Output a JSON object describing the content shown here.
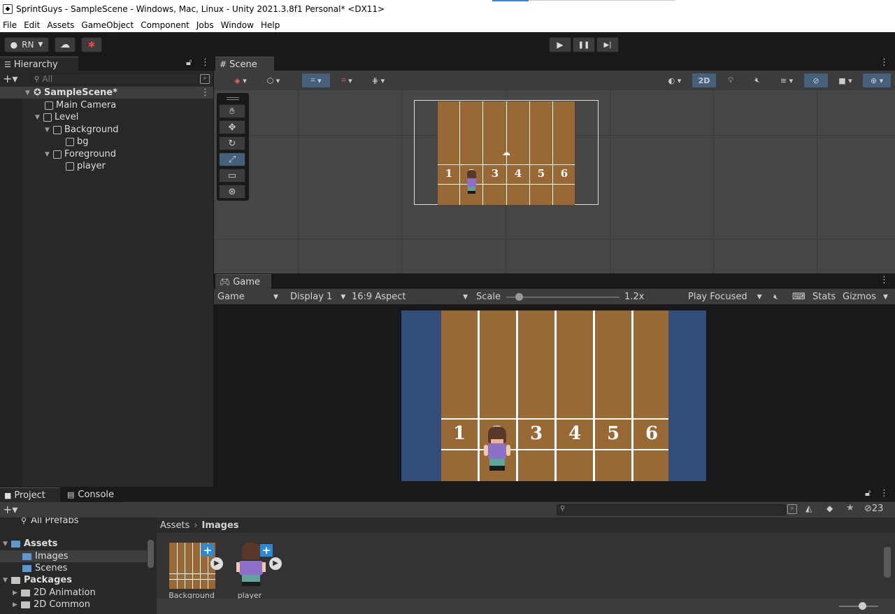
{
  "window": {
    "title": "SprintGuys - SampleScene - Windows, Mac, Linux - Unity 2021.3.8f1 Personal* <DX11>"
  },
  "menu": [
    "File",
    "Edit",
    "Assets",
    "GameObject",
    "Component",
    "Jobs",
    "Window",
    "Help"
  ],
  "toolbar": {
    "account": "RN",
    "play_icon": "▶",
    "pause_icon": "❚❚",
    "step_icon": "▶|"
  },
  "hierarchy": {
    "tab": "Hierarchy",
    "search_placeholder": "All",
    "items": [
      {
        "label": "SampleScene*",
        "depth": 0
      },
      {
        "label": "Main Camera",
        "depth": 1
      },
      {
        "label": "Level",
        "depth": 1
      },
      {
        "label": "Background",
        "depth": 2
      },
      {
        "label": "bg",
        "depth": 3
      },
      {
        "label": "Foreground",
        "depth": 2
      },
      {
        "label": "player",
        "depth": 3
      }
    ]
  },
  "scene": {
    "tab": "Scene",
    "mode_2d": "2D",
    "lane_numbers": [
      "1",
      "2",
      "3",
      "4",
      "5",
      "6"
    ]
  },
  "game": {
    "tab": "Game",
    "view_select": "Game",
    "display": "Display 1",
    "aspect": "16:9 Aspect",
    "scale_label": "Scale",
    "scale_value": "1.2x",
    "scale_slider_value": 0.03,
    "play_mode": "Play Focused",
    "stats": "Stats",
    "gizmos": "Gizmos",
    "lane_numbers": [
      "1",
      "2",
      "3",
      "4",
      "5",
      "6"
    ]
  },
  "project": {
    "tabs": [
      "Project",
      "Console"
    ],
    "favorites_item": "All Prefabs",
    "tree": [
      {
        "label": "Assets",
        "bold": true
      },
      {
        "label": "Images"
      },
      {
        "label": "Scenes"
      },
      {
        "label": "Packages",
        "bold": true
      },
      {
        "label": "2D Animation"
      },
      {
        "label": "2D Common"
      }
    ],
    "breadcrumb": [
      "Assets",
      "Images"
    ],
    "assets": [
      "Background",
      "player"
    ],
    "hidden_count": "23"
  },
  "colors": {
    "track": "#986835",
    "game_bg": "#314d79",
    "active_tool": "#46607c",
    "editor_bg": "#282828"
  }
}
